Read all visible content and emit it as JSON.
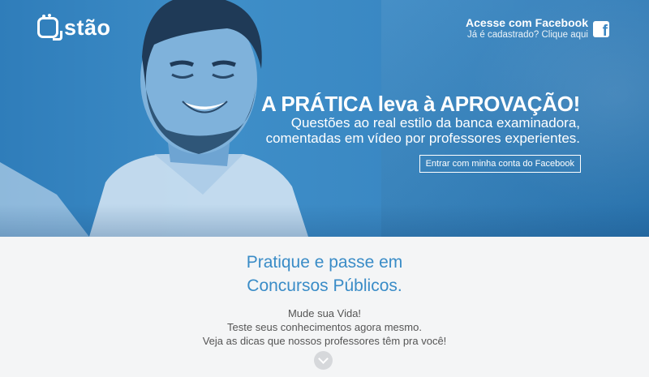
{
  "header": {
    "logo_text": "stão",
    "facebook_title": "Acesse com Facebook",
    "facebook_sub": "Já é cadastrado? Clique aqui",
    "facebook_icon": "facebook-icon",
    "facebook_glyph": "f"
  },
  "hero": {
    "headline": "A PRÁTICA leva à APROVAÇÃO!",
    "sub_line_1": "Questões ao real estilo da banca examinadora,",
    "sub_line_2": "comentadas em vídeo por professores experientes.",
    "cta_label": "Entrar com minha conta do Facebook"
  },
  "section": {
    "title_line_1": "Pratique e passe em",
    "title_line_2": "Concursos Públicos.",
    "body_line_1": "Mude sua Vida!",
    "body_line_2": "Teste seus conhecimentos agora mesmo.",
    "body_line_3": "Veja as dicas que nossos professores têm pra você!",
    "scroll_icon": "chevron-down-icon"
  },
  "colors": {
    "brand_blue": "#3a8cc7",
    "hero_blue": "#3e8ec8",
    "background": "#f4f5f6",
    "text_gray": "#555555"
  }
}
